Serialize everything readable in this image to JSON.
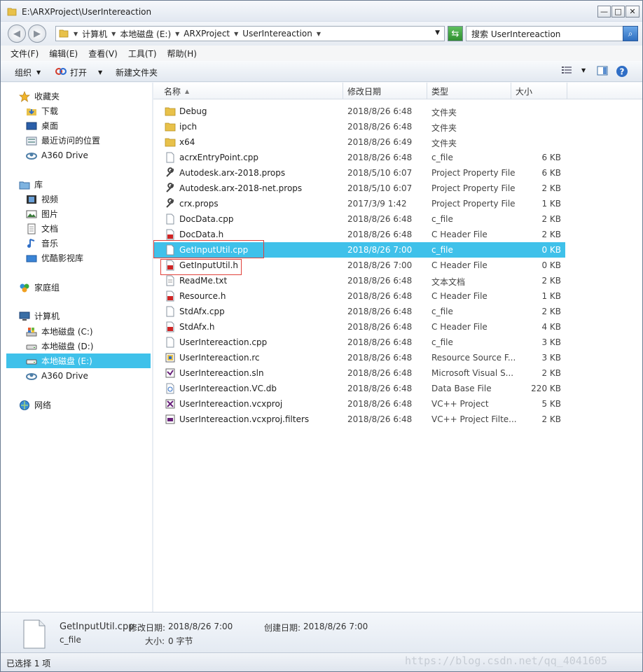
{
  "window": {
    "title": "E:\\ARXProject\\UserIntereaction",
    "buttons": {
      "minimize": "—",
      "maximize": "□",
      "close": "✕"
    }
  },
  "address": {
    "crumbs": [
      "计算机",
      "本地磁盘 (E:)",
      "ARXProject",
      "UserIntereaction"
    ],
    "search_placeholder": "搜索 UserIntereaction"
  },
  "menu": [
    "文件(F)",
    "编辑(E)",
    "查看(V)",
    "工具(T)",
    "帮助(H)"
  ],
  "toolbar": {
    "organize": "组织",
    "open": "打开",
    "new_folder": "新建文件夹"
  },
  "nav": {
    "favorites": {
      "label": "收藏夹",
      "items": [
        "下载",
        "桌面",
        "最近访问的位置",
        "A360 Drive"
      ]
    },
    "libraries": {
      "label": "库",
      "items": [
        "视频",
        "图片",
        "文档",
        "音乐",
        "优酷影视库"
      ]
    },
    "homegroup": "家庭组",
    "computer": {
      "label": "计算机",
      "items": [
        "本地磁盘 (C:)",
        "本地磁盘 (D:)",
        "本地磁盘 (E:)",
        "A360 Drive"
      ]
    },
    "network": "网络"
  },
  "columns": {
    "name": "名称",
    "date": "修改日期",
    "type": "类型",
    "size": "大小"
  },
  "files": [
    {
      "name": "Debug",
      "date": "2018/8/26 6:48",
      "type": "文件夹",
      "size": "",
      "icon": "folder"
    },
    {
      "name": "ipch",
      "date": "2018/8/26 6:48",
      "type": "文件夹",
      "size": "",
      "icon": "folder"
    },
    {
      "name": "x64",
      "date": "2018/8/26 6:49",
      "type": "文件夹",
      "size": "",
      "icon": "folder"
    },
    {
      "name": "acrxEntryPoint.cpp",
      "date": "2018/8/26 6:48",
      "type": "c_file",
      "size": "6 KB",
      "icon": "file"
    },
    {
      "name": "Autodesk.arx-2018.props",
      "date": "2018/5/10 6:07",
      "type": "Project Property File",
      "size": "6 KB",
      "icon": "wrench"
    },
    {
      "name": "Autodesk.arx-2018-net.props",
      "date": "2018/5/10 6:07",
      "type": "Project Property File",
      "size": "2 KB",
      "icon": "wrench"
    },
    {
      "name": "crx.props",
      "date": "2017/3/9 1:42",
      "type": "Project Property File",
      "size": "1 KB",
      "icon": "wrench"
    },
    {
      "name": "DocData.cpp",
      "date": "2018/8/26 6:48",
      "type": "c_file",
      "size": "2 KB",
      "icon": "file"
    },
    {
      "name": "DocData.h",
      "date": "2018/8/26 6:48",
      "type": "C Header File",
      "size": "2 KB",
      "icon": "header"
    },
    {
      "name": "GetInputUtil.cpp",
      "date": "2018/8/26 7:00",
      "type": "c_file",
      "size": "0 KB",
      "icon": "file",
      "selected": true
    },
    {
      "name": "GetInputUtil.h",
      "date": "2018/8/26 7:00",
      "type": "C Header File",
      "size": "0 KB",
      "icon": "header"
    },
    {
      "name": "ReadMe.txt",
      "date": "2018/8/26 6:48",
      "type": "文本文档",
      "size": "2 KB",
      "icon": "text"
    },
    {
      "name": "Resource.h",
      "date": "2018/8/26 6:48",
      "type": "C Header File",
      "size": "1 KB",
      "icon": "header"
    },
    {
      "name": "StdAfx.cpp",
      "date": "2018/8/26 6:48",
      "type": "c_file",
      "size": "2 KB",
      "icon": "file"
    },
    {
      "name": "StdAfx.h",
      "date": "2018/8/26 6:48",
      "type": "C Header File",
      "size": "4 KB",
      "icon": "header"
    },
    {
      "name": "UserIntereaction.cpp",
      "date": "2018/8/26 6:48",
      "type": "c_file",
      "size": "3 KB",
      "icon": "file"
    },
    {
      "name": "UserIntereaction.rc",
      "date": "2018/8/26 6:48",
      "type": "Resource Source F...",
      "size": "3 KB",
      "icon": "rc"
    },
    {
      "name": "UserIntereaction.sln",
      "date": "2018/8/26 6:48",
      "type": "Microsoft Visual S...",
      "size": "2 KB",
      "icon": "sln"
    },
    {
      "name": "UserIntereaction.VC.db",
      "date": "2018/8/26 6:48",
      "type": "Data Base File",
      "size": "220 KB",
      "icon": "db"
    },
    {
      "name": "UserIntereaction.vcxproj",
      "date": "2018/8/26 6:48",
      "type": "VC++ Project",
      "size": "5 KB",
      "icon": "vcx"
    },
    {
      "name": "UserIntereaction.vcxproj.filters",
      "date": "2018/8/26 6:48",
      "type": "VC++ Project Filte...",
      "size": "2 KB",
      "icon": "filters"
    }
  ],
  "details": {
    "filename": "GetInputUtil.cpp",
    "filetype": "c_file",
    "modified_label": "修改日期:",
    "modified_value": "2018/8/26 7:00",
    "size_label": "大小:",
    "size_value": "0 字节",
    "created_label": "创建日期:",
    "created_value": "2018/8/26 7:00"
  },
  "status": "已选择 1 项",
  "watermark": "https://blog.csdn.net/qq_4041605",
  "colors": {
    "selection": "#3fc1ea",
    "highlight_box": "#e0403a"
  }
}
